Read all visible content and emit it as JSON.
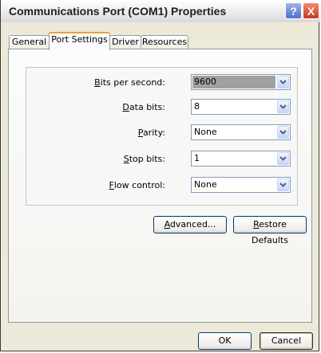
{
  "window": {
    "title": "Communications Port (COM1) Properties",
    "help_glyph": "?",
    "close_glyph": "X"
  },
  "tabs": [
    {
      "label": "General"
    },
    {
      "label": "Port Settings",
      "active": true
    },
    {
      "label": "Driver"
    },
    {
      "label": "Resources"
    }
  ],
  "settings": {
    "bits_per_second": {
      "label_pre": "",
      "label_u": "B",
      "label_post": "its per second:",
      "value": "9600"
    },
    "data_bits": {
      "label_pre": "",
      "label_u": "D",
      "label_post": "ata bits:",
      "value": "8"
    },
    "parity": {
      "label_pre": "",
      "label_u": "P",
      "label_post": "arity:",
      "value": "None"
    },
    "stop_bits": {
      "label_pre": "",
      "label_u": "S",
      "label_post": "top bits:",
      "value": "1"
    },
    "flow_control": {
      "label_pre": "",
      "label_u": "F",
      "label_post": "low control:",
      "value": "None"
    }
  },
  "buttons": {
    "advanced": {
      "u": "A",
      "rest": "dvanced..."
    },
    "restore": {
      "u": "R",
      "rest": "estore Defaults"
    },
    "ok": "OK",
    "cancel": "Cancel"
  },
  "icons": {
    "dropdown": "chevron-down-icon",
    "help": "help-icon",
    "close": "close-icon"
  },
  "colors": {
    "accent_tab": "#e9a13a",
    "close_red": "#c9391b",
    "help_blue": "#4d70c9",
    "selection_gray": "#a0a0a0"
  }
}
